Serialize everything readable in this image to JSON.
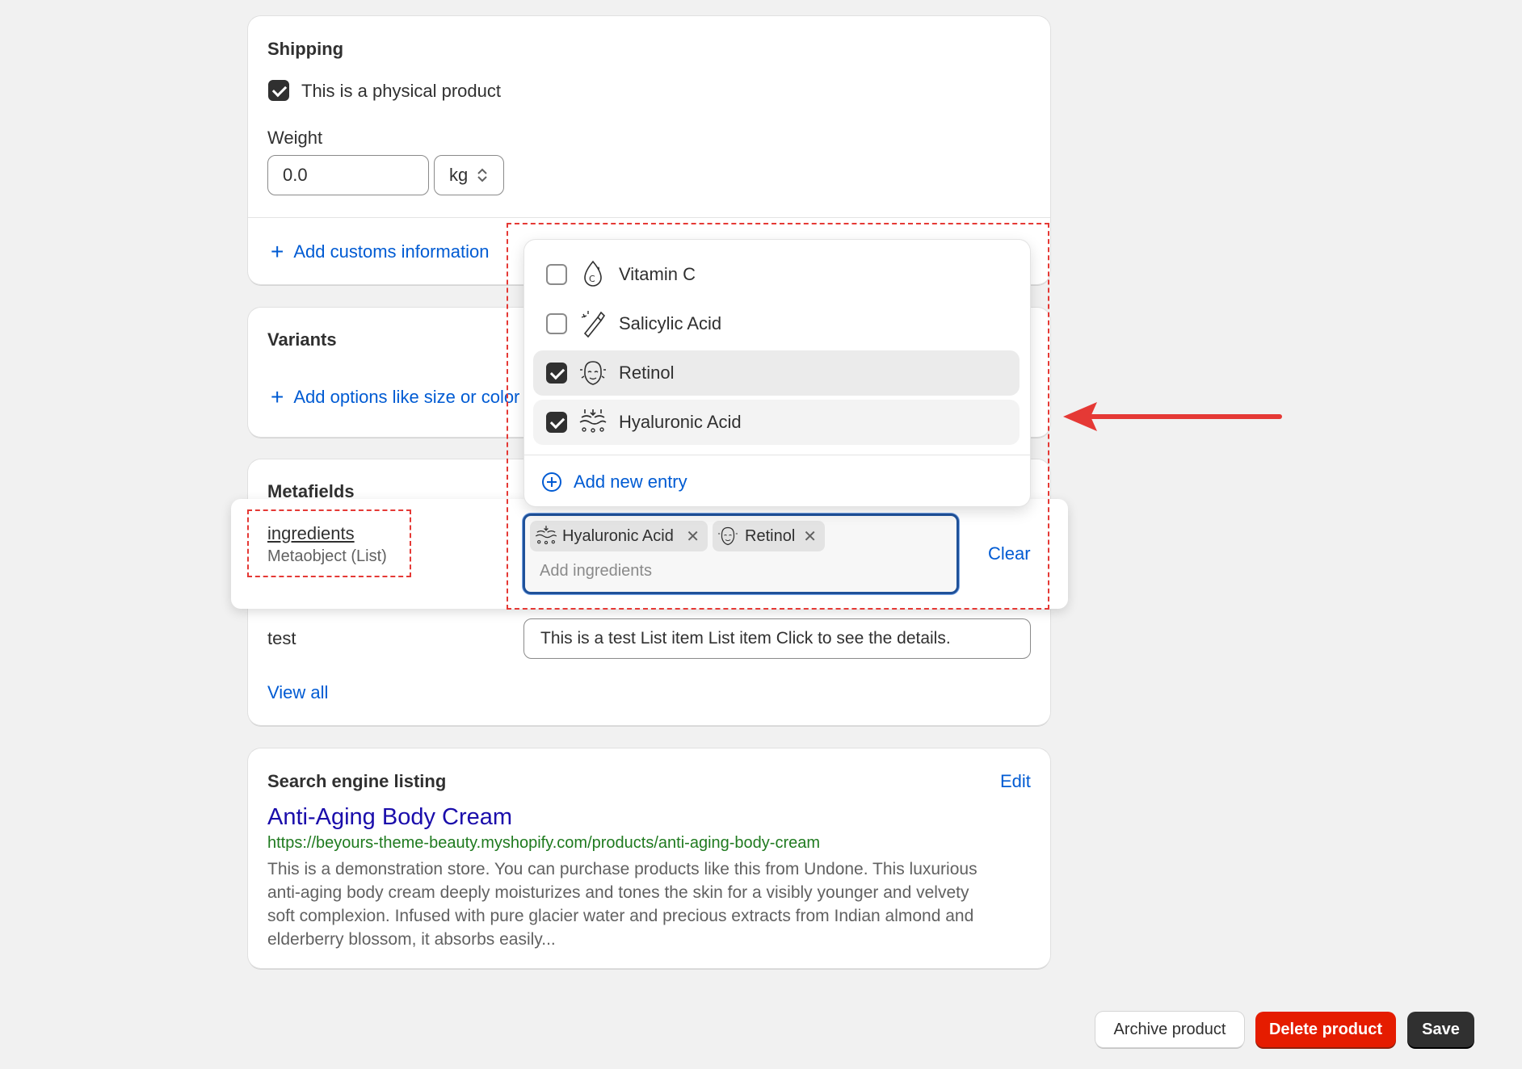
{
  "shipping": {
    "title": "Shipping",
    "physical_label": "This is a physical product",
    "weight_label": "Weight",
    "weight_value": "0.0",
    "unit": "kg",
    "customs_link": "Add customs information"
  },
  "variants": {
    "title": "Variants",
    "add_options_link": "Add options like size or color"
  },
  "metafields": {
    "title": "Metafields",
    "ingredients_name": "ingredients",
    "ingredients_type": "Metaobject (List)",
    "chips": [
      {
        "label": "Hyaluronic Acid",
        "icon": "hyaluronic-acid-icon"
      },
      {
        "label": "Retinol",
        "icon": "retinol-icon"
      }
    ],
    "input_placeholder": "Add ingredients",
    "clear_label": "Clear",
    "test_name": "test",
    "test_value": "This is a test List item List item Click to see the details.",
    "view_all": "View all"
  },
  "dropdown": {
    "items": [
      {
        "label": "Vitamin C",
        "checked": false,
        "icon": "vitamin-c-icon"
      },
      {
        "label": "Salicylic Acid",
        "checked": false,
        "icon": "salicylic-acid-icon"
      },
      {
        "label": "Retinol",
        "checked": true,
        "icon": "retinol-icon"
      },
      {
        "label": "Hyaluronic Acid",
        "checked": true,
        "icon": "hyaluronic-acid-icon"
      }
    ],
    "add_new": "Add new entry"
  },
  "seo": {
    "title": "Search engine listing",
    "edit": "Edit",
    "page_title": "Anti-Aging Body Cream",
    "url": "https://beyours-theme-beauty.myshopify.com/products/anti-aging-body-cream",
    "description_lines": [
      "This is a demonstration store. You can purchase products like this from Undone. This luxurious",
      "anti-aging body cream deeply moisturizes and tones the skin for a visibly younger and velvety",
      "soft complexion. Infused with pure glacier water and precious extracts from Indian almond and",
      "elderberry blossom, it absorbs easily..."
    ]
  },
  "actions": {
    "archive": "Archive product",
    "delete": "Delete product",
    "save": "Save"
  },
  "colors": {
    "link": "#005bd3",
    "delete": "#e51c00",
    "annotation": "#e53935",
    "seo_url": "#1f7a1f",
    "seo_title": "#1a0dab"
  }
}
